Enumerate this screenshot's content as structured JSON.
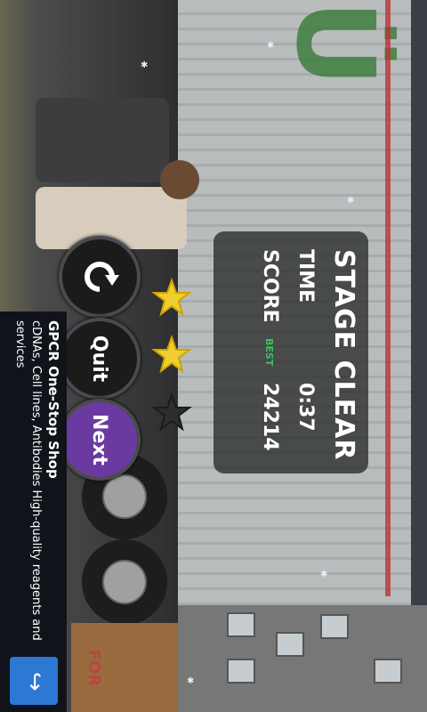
{
  "panel": {
    "title": "STAGE CLEAR",
    "time_label": "TIME",
    "time_value": "0:37",
    "score_label": "SCORE",
    "best_label": "BEST",
    "score_value": "24214"
  },
  "stars": {
    "earned": 2,
    "total": 3
  },
  "buttons": {
    "retry_icon": "retry-arrow",
    "quit_label": "Quit",
    "next_label": "Next"
  },
  "ad": {
    "title": "GPCR One-Stop Shop",
    "body": "cDNAs, Cell lines, Antibodies High-quality reagents and services",
    "icon": "arrow-right-icon",
    "brand_color": "#2c78d2"
  },
  "scene": {
    "sign_text": "FOR",
    "accent_color": "#3ec25a"
  }
}
